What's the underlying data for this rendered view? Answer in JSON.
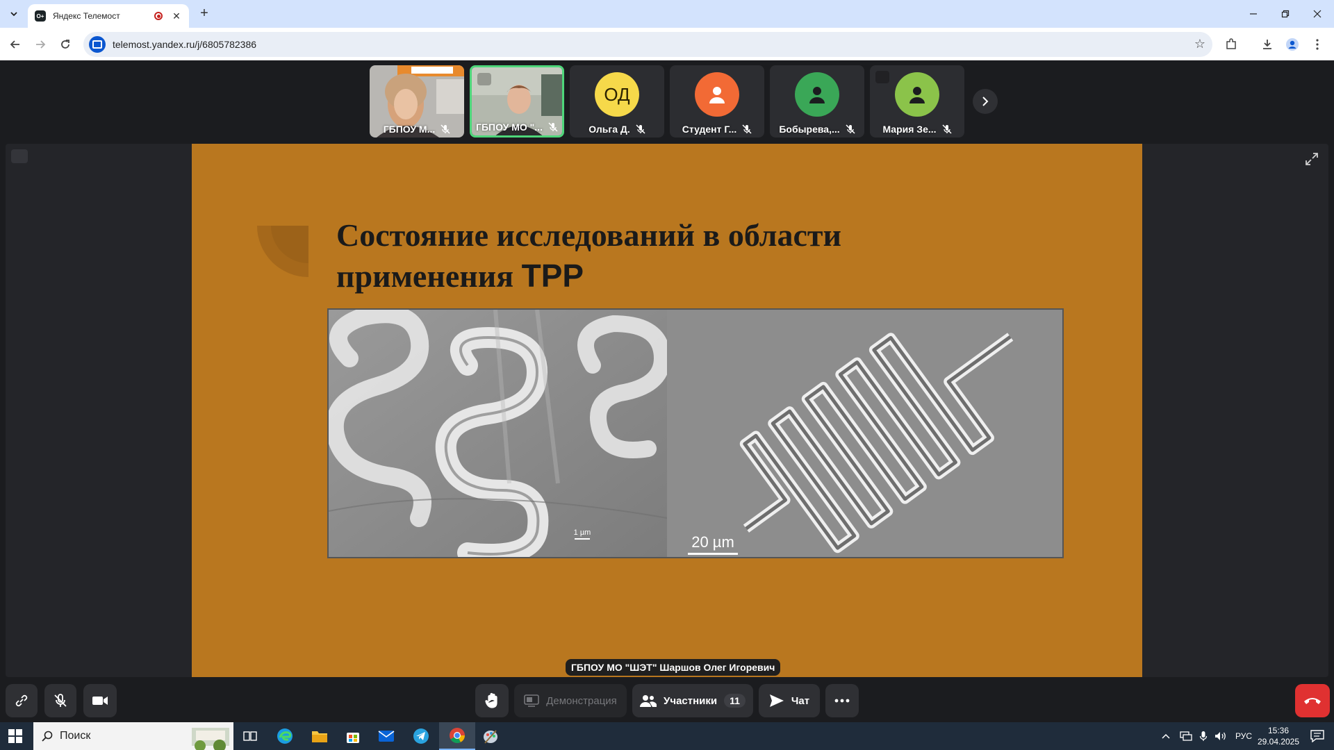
{
  "browser": {
    "tab_title": "Яндекс Телемост",
    "tab_favicon_text": "О+",
    "url": "telemost.yandex.ru/j/6805782386"
  },
  "participants": [
    {
      "name": "ГБПОУ М...",
      "type": "video"
    },
    {
      "name": "ГБПОУ МО \"...",
      "type": "video",
      "active": true
    },
    {
      "name": "Ольга Д.",
      "type": "initials",
      "initials": "ОД",
      "color": "#f6d94a"
    },
    {
      "name": "Студент Г...",
      "type": "avatar",
      "color": "#f26a35"
    },
    {
      "name": "Бобырева,...",
      "type": "avatar",
      "color": "#3aa757"
    },
    {
      "name": "Мария Зе...",
      "type": "avatar",
      "color": "#8bc34a"
    }
  ],
  "slide": {
    "title_line1": "Состояние исследований в области",
    "title_line2_serif": "применения ",
    "title_line2_sans": "ТРР",
    "scale_left": "1 µm",
    "scale_right": "20 µm"
  },
  "speaker": "ГБПОУ МО \"ШЭТ\" Шаршов Олег Игоревич",
  "controls": {
    "screen_share_label": "Демонстрация",
    "participants_label": "Участники",
    "participants_count": "11",
    "chat_label": "Чат"
  },
  "taskbar": {
    "search_placeholder": "Поиск",
    "language": "РУС",
    "time": "15:36",
    "date": "29.04.2025"
  },
  "colors": {
    "active_speaker": "#4ed67a",
    "slide_bg": "#b9771f",
    "hangup": "#e03131"
  }
}
